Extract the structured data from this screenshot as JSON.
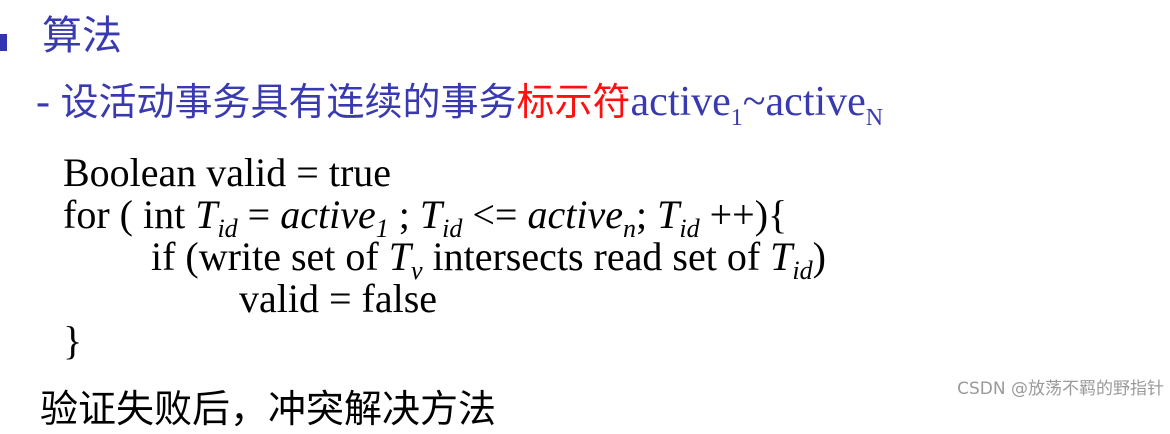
{
  "heading": "算法",
  "subtitle": {
    "prefix": "- ",
    "text_blue": "设活动事务具有连续的事务",
    "text_red": "标示符",
    "var1_base": "active",
    "var1_sub": "1",
    "tilde": "~",
    "var2_base": "active",
    "var2_sub": "N"
  },
  "code": {
    "line1": "Boolean valid = true",
    "for_kw": "for ( int ",
    "t": "T",
    "id": "id",
    "eq": " = ",
    "active": "active",
    "sub1": "1",
    "semi": " ; ",
    "le": " <= ",
    "subn": "n",
    "semi2": "; ",
    "inc": " ++){",
    "if_start": "if (write set of ",
    "subv": "v",
    "if_mid": " intersects read set of ",
    "if_end": ")",
    "line4": "valid = false",
    "line5": "}"
  },
  "bottom_text": "验证失败后，冲突解决方法",
  "watermark": "CSDN @放荡不羁的野指针"
}
